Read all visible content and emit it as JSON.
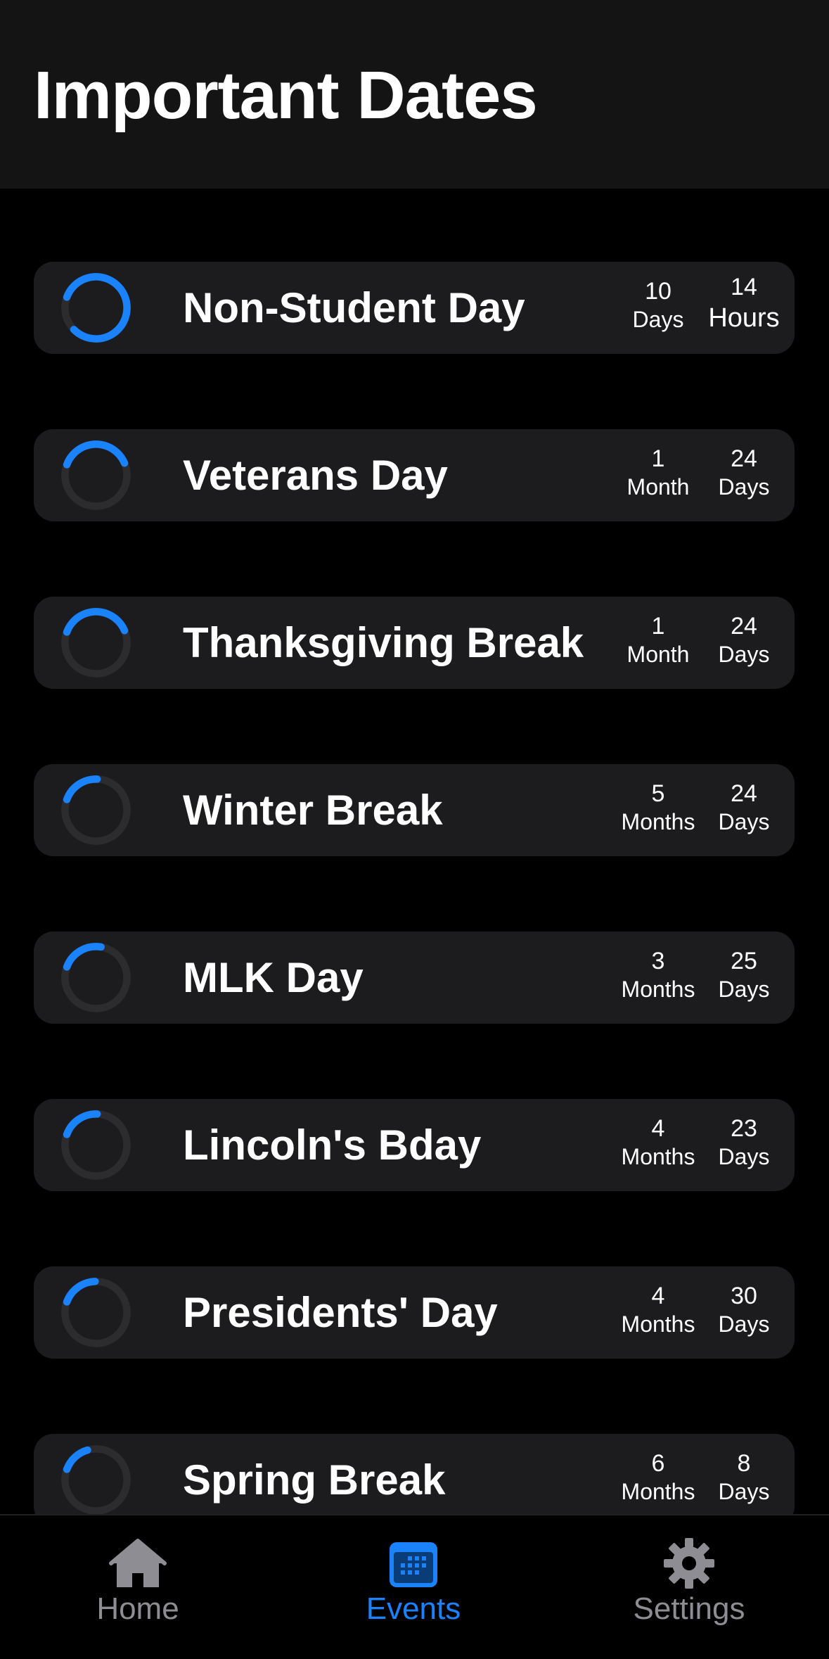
{
  "header": {
    "title": "Important Dates"
  },
  "colors": {
    "accent": "#1a82fb",
    "ring_track": "#2c2c2e",
    "card_bg": "#1c1c1e",
    "tab_inactive": "#8d8d93"
  },
  "events": [
    {
      "name": "Non-Student Day",
      "n1": "10",
      "l1": "Days",
      "n2": "14",
      "l2": "Hours",
      "progress": 0.82
    },
    {
      "name": "Veterans Day",
      "n1": "1",
      "l1": "Month",
      "n2": "24",
      "l2": "Days",
      "progress": 0.38
    },
    {
      "name": "Thanksgiving Break",
      "n1": "1",
      "l1": "Month",
      "n2": "24",
      "l2": "Days",
      "progress": 0.38
    },
    {
      "name": "Winter Break",
      "n1": "5",
      "l1": "Months",
      "n2": "24",
      "l2": "Days",
      "progress": 0.2
    },
    {
      "name": "MLK Day",
      "n1": "3",
      "l1": "Months",
      "n2": "25",
      "l2": "Days",
      "progress": 0.22
    },
    {
      "name": "Lincoln's Bday",
      "n1": "4",
      "l1": "Months",
      "n2": "23",
      "l2": "Days",
      "progress": 0.2
    },
    {
      "name": "Presidents' Day",
      "n1": "4",
      "l1": "Months",
      "n2": "30",
      "l2": "Days",
      "progress": 0.19
    },
    {
      "name": "Spring Break",
      "n1": "6",
      "l1": "Months",
      "n2": "8",
      "l2": "Days",
      "progress": 0.15
    }
  ],
  "tabs": [
    {
      "label": "Home",
      "icon": "house-icon",
      "active": false
    },
    {
      "label": "Events",
      "icon": "calendar-icon",
      "active": true
    },
    {
      "label": "Settings",
      "icon": "gear-icon",
      "active": false
    }
  ]
}
